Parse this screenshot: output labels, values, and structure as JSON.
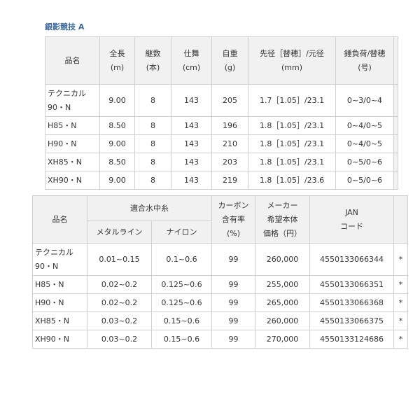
{
  "title": "銀影競技 A",
  "table1": {
    "headers": [
      "品名",
      "全長\n(m)",
      "継数\n(本)",
      "仕舞\n(cm)",
      "自重\n(g)",
      "先径［替穂］/元径\n(mm)",
      "錘負荷/替穂\n(号)"
    ],
    "rows": [
      [
        "テクニカル\n90・N",
        "9.00",
        "8",
        "143",
        "205",
        "1.7［1.05］/23.1",
        "0~3/0~4"
      ],
      [
        "H85・N",
        "8.50",
        "8",
        "143",
        "196",
        "1.8［1.05］/23.1",
        "0~4/0~5"
      ],
      [
        "H90・N",
        "9.00",
        "8",
        "143",
        "210",
        "1.8［1.05］/23.1",
        "0~4/0~5"
      ],
      [
        "XH85・N",
        "8.50",
        "8",
        "143",
        "203",
        "1.8［1.05］/23.1",
        "0~5/0~6"
      ],
      [
        "XH90・N",
        "9.00",
        "8",
        "143",
        "219",
        "1.8［1.05］/23.6",
        "0~5/0~6"
      ]
    ]
  },
  "table2": {
    "headers": {
      "name": "品名",
      "line_group": "適合水中糸",
      "metal": "メタルライン",
      "nylon": "ナイロン",
      "carbon": "カーボン\n含有率\n(%)",
      "price": "メーカー\n希望本体\n価格（円）",
      "jan": "JAN\nコード"
    },
    "rows": [
      [
        "テクニカル\n90・N",
        "0.01~0.15",
        "0.1~0.6",
        "99",
        "260,000",
        "4550133066344",
        "*"
      ],
      [
        "H85・N",
        "0.02~0.2",
        "0.125~0.6",
        "99",
        "255,000",
        "4550133066351",
        "*"
      ],
      [
        "H90・N",
        "0.02~0.2",
        "0.125~0.6",
        "99",
        "265,000",
        "4550133066368",
        "*"
      ],
      [
        "XH85・N",
        "0.03~0.2",
        "0.15~0.6",
        "99",
        "260,000",
        "4550133066375",
        "*"
      ],
      [
        "XH90・N",
        "0.03~0.2",
        "0.15~0.6",
        "99",
        "270,000",
        "4550133124686",
        "*"
      ]
    ]
  }
}
